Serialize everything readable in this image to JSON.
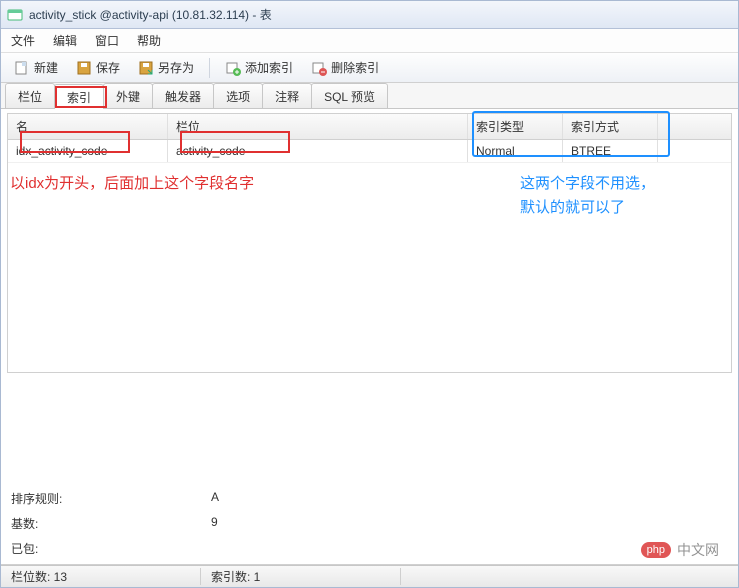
{
  "window": {
    "title": "activity_stick @activity-api (10.81.32.114) - 表"
  },
  "menu": {
    "file": "文件",
    "edit": "编辑",
    "window": "窗口",
    "help": "帮助"
  },
  "toolbar": {
    "new": "新建",
    "save": "保存",
    "saveas": "另存为",
    "addindex": "添加索引",
    "delindex": "删除索引"
  },
  "tabs": {
    "fields": "栏位",
    "indexes": "索引",
    "fkeys": "外键",
    "triggers": "触发器",
    "options": "选项",
    "comment": "注释",
    "sqlpreview": "SQL 预览"
  },
  "grid": {
    "headers": {
      "name": "名",
      "field": "栏位",
      "type": "索引类型",
      "method": "索引方式"
    },
    "rows": [
      {
        "name": "idx_activity_code",
        "field": "activity_code",
        "type": "Normal",
        "method": "BTREE"
      }
    ]
  },
  "details": {
    "sort_label": "排序规则:",
    "sort_value": "A",
    "card_label": "基数:",
    "card_value": "9",
    "packed_label": "已包:",
    "packed_value": ""
  },
  "status": {
    "fields": "栏位数: 13",
    "indexes": "索引数: 1"
  },
  "watermark": {
    "badge": "php",
    "text": "中文网"
  },
  "annotations": {
    "red_text": "以idx为开头，后面加上这个字段名字",
    "blue_text_l1": "这两个字段不用选，",
    "blue_text_l2": "默认的就可以了"
  }
}
